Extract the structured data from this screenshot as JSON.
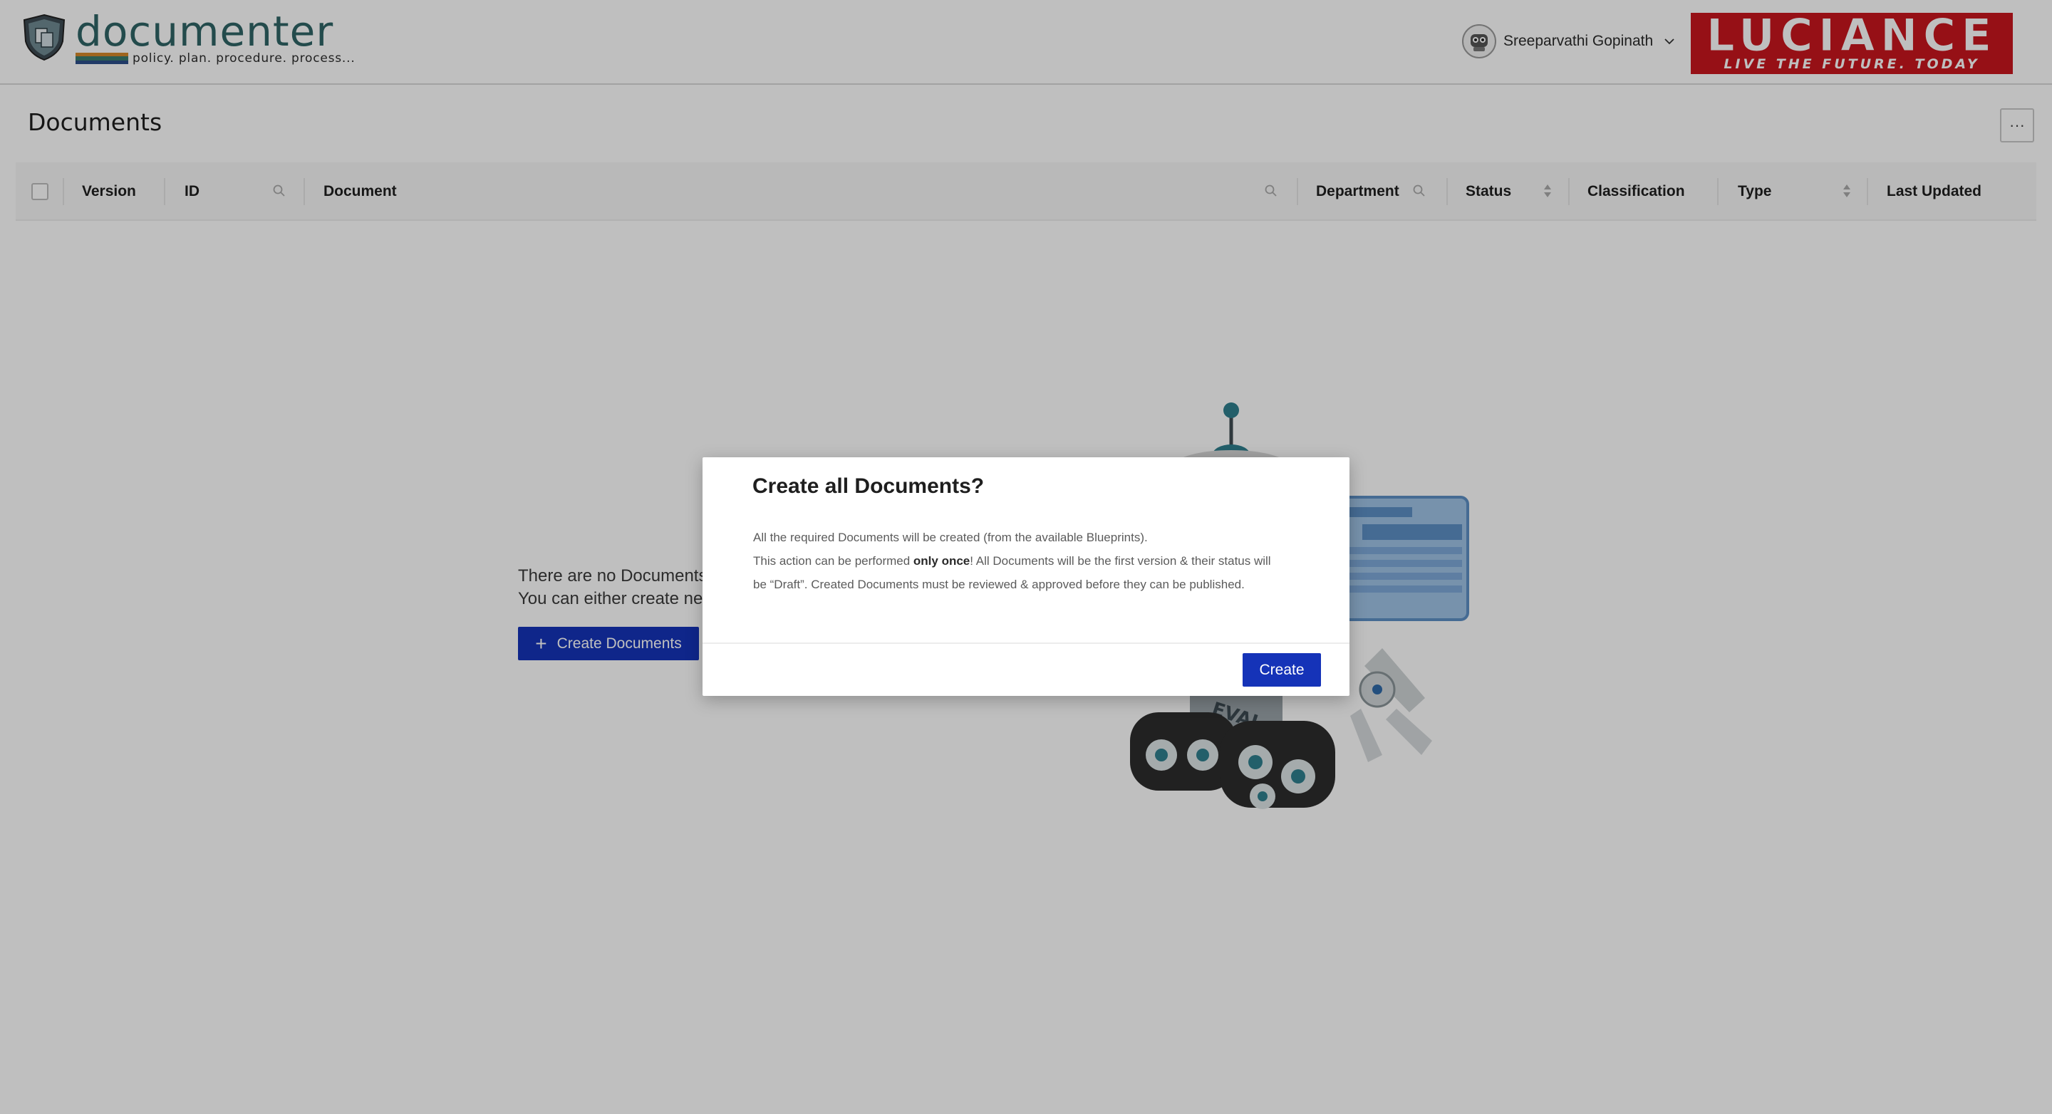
{
  "header": {
    "app_name": "documenter",
    "tagline": "policy. plan. procedure. process...",
    "user_name": "Sreeparvathi Gopinath",
    "brand_name": "LUCIANCE",
    "brand_tagline": "LIVE THE FUTURE. TODAY"
  },
  "page": {
    "title": "Documents",
    "more_label": "···"
  },
  "table": {
    "columns": [
      "Version",
      "ID",
      "Document",
      "Department",
      "Status",
      "Classification",
      "Type",
      "Last Updated"
    ]
  },
  "empty_state": {
    "line1": "There are no Documents",
    "line2": "You can either create ne",
    "create_button": "Create Documents",
    "robot_label": "EVAL"
  },
  "modal": {
    "title": "Create all Documents?",
    "line1": "All the required Documents will be created (from the available Blueprints).",
    "line2_pre": "This action can be performed ",
    "line2_bold": "only once",
    "line2_post": "! All Documents will be the first version & their status will",
    "line3": "be “Draft”. Created Documents must be reviewed & approved before they can be published.",
    "create_button": "Create"
  },
  "colors": {
    "primary": "#1533b8",
    "logo_teal": "#2f6466",
    "brand_red": "#c9161e",
    "overlay": "rgba(0,0,0,0.25)"
  }
}
